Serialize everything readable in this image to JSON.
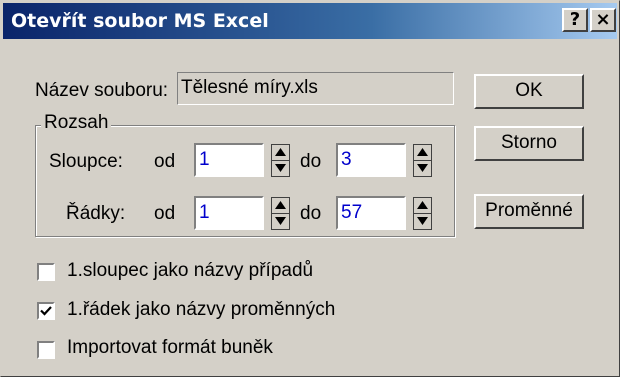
{
  "window": {
    "title": "Otevřít soubor MS Excel",
    "help_label": "?",
    "close_label": "×"
  },
  "file": {
    "label": "Název souboru:",
    "value": "Tělesné míry.xls"
  },
  "range": {
    "group_label": "Rozsah",
    "columns": {
      "label": "Sloupce:",
      "from_label": "od",
      "from_value": "1",
      "to_label": "do",
      "to_value": "3"
    },
    "rows": {
      "label": "Řádky:",
      "from_label": "od",
      "from_value": "1",
      "to_label": "do",
      "to_value": "57"
    }
  },
  "buttons": {
    "ok": "OK",
    "cancel": "Storno",
    "variables": "Proměnné"
  },
  "options": [
    {
      "label": "1.sloupec jako názvy případů",
      "checked": false
    },
    {
      "label": "1.řádek jako názvy proměnných",
      "checked": true
    },
    {
      "label": "Importovat formát buněk",
      "checked": false
    }
  ]
}
